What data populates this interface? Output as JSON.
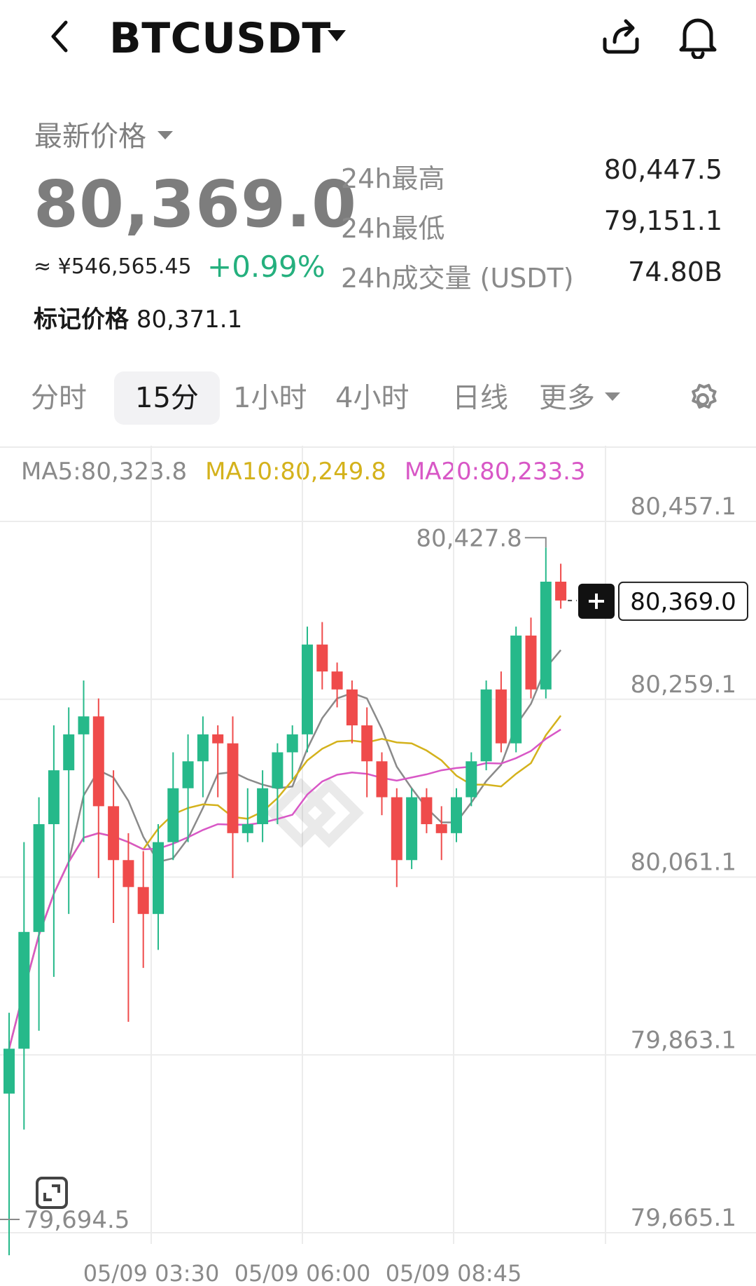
{
  "header": {
    "symbol": "BTCUSDT"
  },
  "price": {
    "label": "最新价格",
    "last": "80,369.0",
    "cny": "≈ ¥546,565.45",
    "change": "+0.99%",
    "mark_label": "标记价格",
    "mark_value": "80,371.1"
  },
  "stats": [
    {
      "label": "24h最高",
      "value": "80,447.5"
    },
    {
      "label": "24h最低",
      "value": "79,151.1"
    },
    {
      "label": "24h成交量 (USDT)",
      "value": "74.80B"
    }
  ],
  "tabs": [
    {
      "label": "分时",
      "active": false
    },
    {
      "label": "15分",
      "active": true
    },
    {
      "label": "1小时",
      "active": false
    },
    {
      "label": "4小时",
      "active": false
    },
    {
      "label": "日线",
      "active": false
    },
    {
      "label": "更多",
      "active": false
    }
  ],
  "ma": {
    "ma5": "MA5:80,323.8",
    "ma10": "MA10:80,249.8",
    "ma20": "MA20:80,233.3"
  },
  "colors": {
    "up": "#26b98a",
    "down": "#ef4b4b",
    "ma5": "#8a8a8a",
    "ma10": "#d4b21c",
    "ma20": "#d857c6",
    "grid": "#ececec"
  },
  "chart_data": {
    "type": "candlestick",
    "y_ticks": [
      "80,457.1",
      "80,259.1",
      "80,061.1",
      "79,863.1",
      "79,665.1"
    ],
    "y_tick_values": [
      80457.1,
      80259.1,
      80061.1,
      79863.1,
      79665.1
    ],
    "x_ticks": [
      "05/09 03:30",
      "05/09 06:00",
      "05/09 08:45"
    ],
    "high_label": "80,427.8",
    "low_label": "79,694.5",
    "current_price": "80,369.0",
    "ylim": [
      79665.1,
      80457.1
    ],
    "candles": [
      {
        "o": 79820,
        "h": 79910,
        "l": 79640,
        "c": 79870
      },
      {
        "o": 79870,
        "h": 80100,
        "l": 79780,
        "c": 80000
      },
      {
        "o": 80000,
        "h": 80150,
        "l": 79890,
        "c": 80120
      },
      {
        "o": 80120,
        "h": 80230,
        "l": 79950,
        "c": 80180
      },
      {
        "o": 80180,
        "h": 80250,
        "l": 80020,
        "c": 80220
      },
      {
        "o": 80220,
        "h": 80280,
        "l": 80100,
        "c": 80240
      },
      {
        "o": 80240,
        "h": 80260,
        "l": 80060,
        "c": 80140
      },
      {
        "o": 80140,
        "h": 80180,
        "l": 80010,
        "c": 80080
      },
      {
        "o": 80080,
        "h": 80110,
        "l": 79900,
        "c": 80050
      },
      {
        "o": 80050,
        "h": 80090,
        "l": 79960,
        "c": 80020
      },
      {
        "o": 80020,
        "h": 80120,
        "l": 79980,
        "c": 80100
      },
      {
        "o": 80100,
        "h": 80200,
        "l": 80080,
        "c": 80160
      },
      {
        "o": 80160,
        "h": 80220,
        "l": 80100,
        "c": 80190
      },
      {
        "o": 80190,
        "h": 80240,
        "l": 80150,
        "c": 80220
      },
      {
        "o": 80220,
        "h": 80230,
        "l": 80150,
        "c": 80210
      },
      {
        "o": 80210,
        "h": 80240,
        "l": 80060,
        "c": 80110
      },
      {
        "o": 80110,
        "h": 80160,
        "l": 80100,
        "c": 80120
      },
      {
        "o": 80120,
        "h": 80180,
        "l": 80100,
        "c": 80160
      },
      {
        "o": 80160,
        "h": 80210,
        "l": 80120,
        "c": 80200
      },
      {
        "o": 80200,
        "h": 80230,
        "l": 80170,
        "c": 80220
      },
      {
        "o": 80220,
        "h": 80340,
        "l": 80200,
        "c": 80320
      },
      {
        "o": 80320,
        "h": 80345,
        "l": 80270,
        "c": 80290
      },
      {
        "o": 80290,
        "h": 80300,
        "l": 80250,
        "c": 80270
      },
      {
        "o": 80270,
        "h": 80280,
        "l": 80210,
        "c": 80230
      },
      {
        "o": 80230,
        "h": 80250,
        "l": 80150,
        "c": 80190
      },
      {
        "o": 80190,
        "h": 80200,
        "l": 80130,
        "c": 80150
      },
      {
        "o": 80150,
        "h": 80160,
        "l": 80050,
        "c": 80080
      },
      {
        "o": 80080,
        "h": 80160,
        "l": 80070,
        "c": 80150
      },
      {
        "o": 80150,
        "h": 80160,
        "l": 80110,
        "c": 80120
      },
      {
        "o": 80120,
        "h": 80140,
        "l": 80080,
        "c": 80110
      },
      {
        "o": 80110,
        "h": 80160,
        "l": 80100,
        "c": 80150
      },
      {
        "o": 80150,
        "h": 80200,
        "l": 80140,
        "c": 80190
      },
      {
        "o": 80190,
        "h": 80280,
        "l": 80180,
        "c": 80270
      },
      {
        "o": 80270,
        "h": 80290,
        "l": 80200,
        "c": 80210
      },
      {
        "o": 80210,
        "h": 80340,
        "l": 80200,
        "c": 80330
      },
      {
        "o": 80330,
        "h": 80350,
        "l": 80260,
        "c": 80270
      },
      {
        "o": 80270,
        "h": 80428,
        "l": 80260,
        "c": 80390
      },
      {
        "o": 80390,
        "h": 80410,
        "l": 80360,
        "c": 80369
      }
    ]
  }
}
